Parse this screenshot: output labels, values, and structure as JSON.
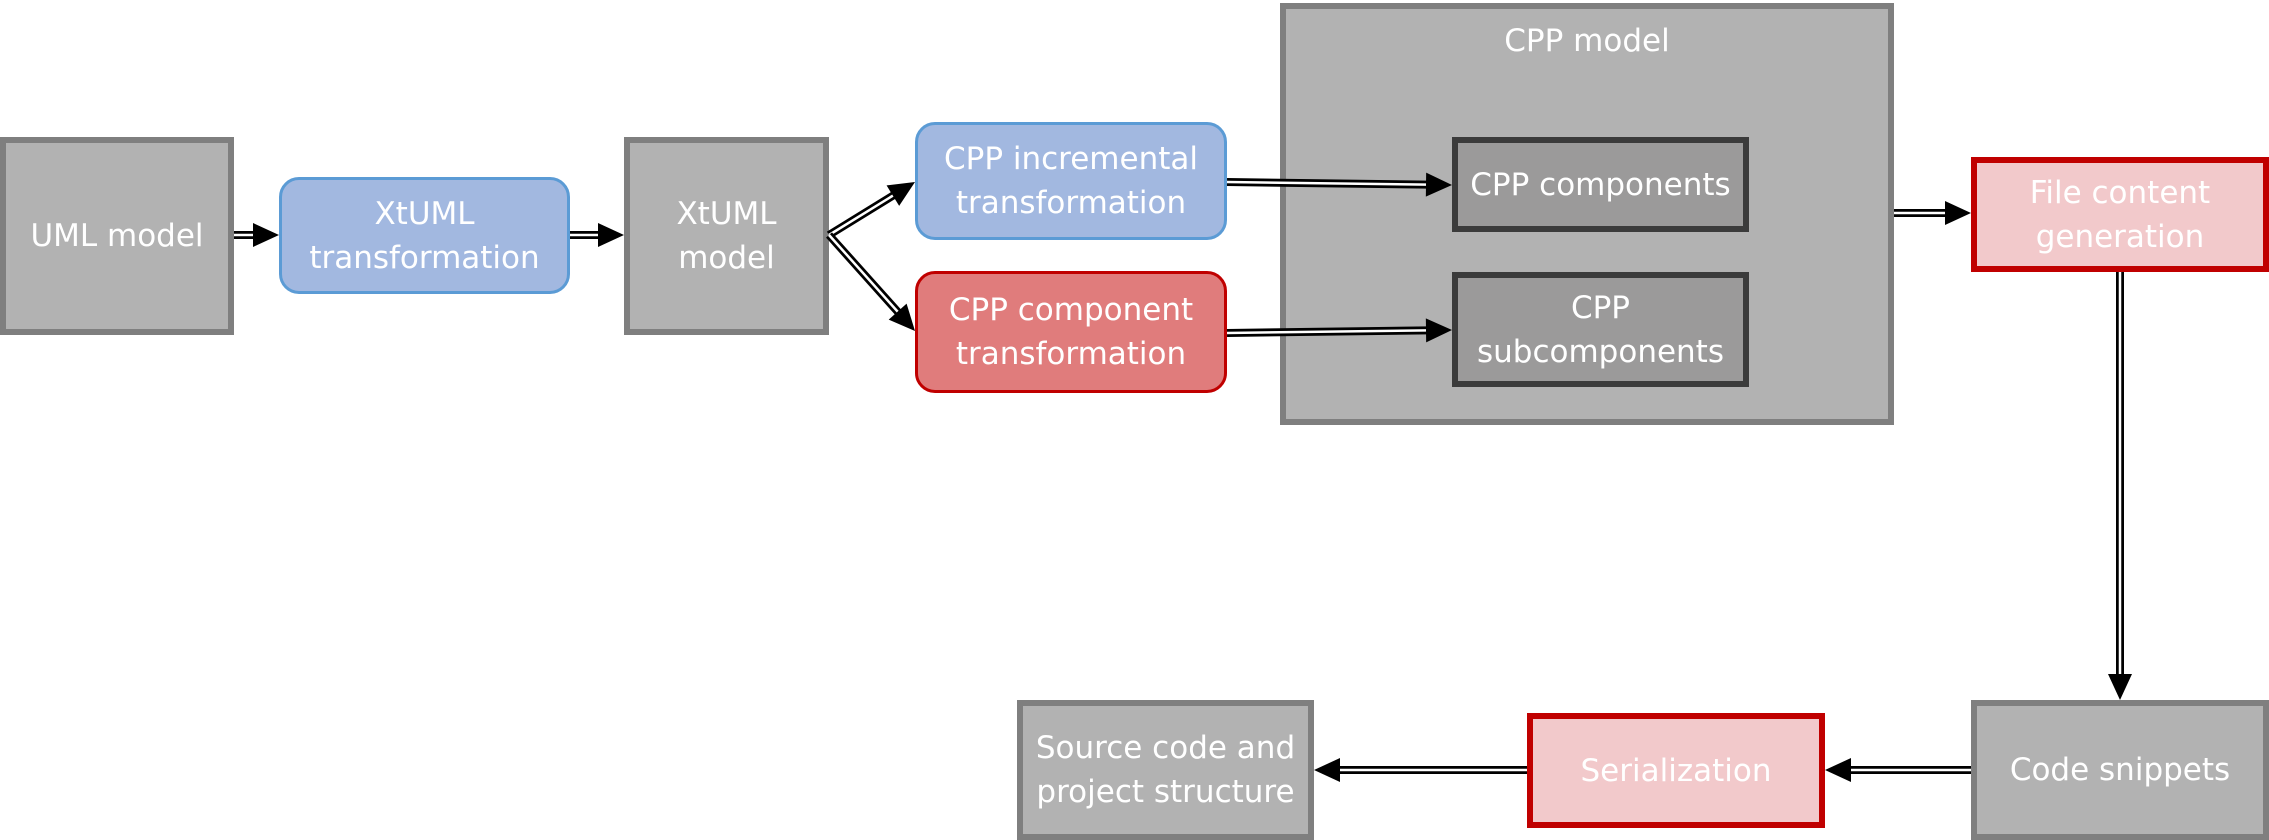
{
  "diagram": {
    "nodes": {
      "uml_model": {
        "label": "UML model",
        "kind": "artifact"
      },
      "xtuml_transformation": {
        "label": "XtUML\ntransformation",
        "kind": "transformation"
      },
      "xtuml_model": {
        "label": "XtUML\nmodel",
        "kind": "artifact"
      },
      "cpp_incremental_transformation": {
        "label": "CPP incremental\ntransformation",
        "kind": "transformation"
      },
      "cpp_component_transformation": {
        "label": "CPP component\ntransformation",
        "kind": "transformation-highlighted"
      },
      "cpp_model": {
        "label": "CPP model",
        "kind": "artifact-container"
      },
      "cpp_components": {
        "label": "CPP components",
        "kind": "artifact-part"
      },
      "cpp_subcomponents": {
        "label": "CPP\nsubcomponents",
        "kind": "artifact-part"
      },
      "file_content_generation": {
        "label": "File content\ngeneration",
        "kind": "step-highlighted"
      },
      "code_snippets": {
        "label": "Code snippets",
        "kind": "artifact"
      },
      "serialization": {
        "label": "Serialization",
        "kind": "step-highlighted"
      },
      "source_code_and_project_structure": {
        "label": "Source code and\nproject structure",
        "kind": "artifact"
      }
    },
    "edges": [
      {
        "from": "UML model",
        "to": "XtUML transformation"
      },
      {
        "from": "XtUML transformation",
        "to": "XtUML model"
      },
      {
        "from": "XtUML model",
        "to": "CPP incremental transformation"
      },
      {
        "from": "XtUML model",
        "to": "CPP component transformation"
      },
      {
        "from": "CPP incremental transformation",
        "to": "CPP components"
      },
      {
        "from": "CPP component transformation",
        "to": "CPP subcomponents"
      },
      {
        "from": "CPP model",
        "to": "File content generation"
      },
      {
        "from": "File content generation",
        "to": "Code snippets"
      },
      {
        "from": "Code snippets",
        "to": "Serialization"
      },
      {
        "from": "Serialization",
        "to": "Source code and project structure"
      }
    ],
    "colors": {
      "artifact_fill": "#b2b2b2",
      "artifact_border": "#7f7f7f",
      "transformation_fill": "#a2b8e0",
      "transformation_border": "#5b9bd5",
      "highlight_fill": "#e07c7c",
      "highlight_border": "#c00000",
      "step_highlight_fill": "#f2c9cb",
      "part_fill": "#9b9a9a",
      "part_border": "#3b3b3b",
      "arrow": "#000000",
      "text": "#ffffff"
    }
  }
}
